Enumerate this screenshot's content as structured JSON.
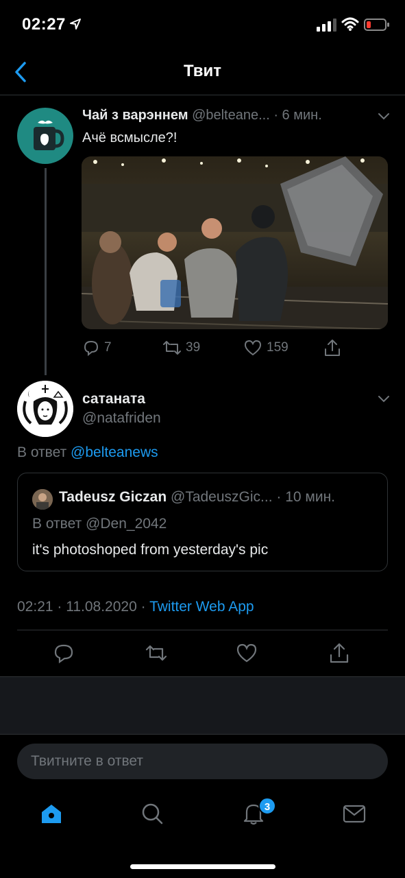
{
  "status_bar": {
    "time": "02:27"
  },
  "header": {
    "title": "Твит"
  },
  "parent_tweet": {
    "name": "Чай з варэннем",
    "handle": "@belteane...",
    "time": "· 6 мин.",
    "text": "Ачё всмысле?!",
    "replies": "7",
    "retweets": "39",
    "likes": "159"
  },
  "reply_tweet": {
    "name": "сатаната",
    "handle": "@natafriden",
    "reply_prefix": "В ответ",
    "reply_to": "@belteanews",
    "quoted": {
      "name": "Tadeusz Giczan",
      "handle": "@TadeuszGic...",
      "time": "· 10 мин.",
      "reply_prefix": "В ответ",
      "reply_to": "@Den_2042",
      "text": "it's photoshoped from yesterday's pic"
    },
    "timestamp": "02:21 · 11.08.2020 ·",
    "source": "Twitter Web App"
  },
  "reply_box": {
    "placeholder": "Твитните в ответ"
  },
  "tab_bar": {
    "notifications_badge": "3"
  },
  "colors": {
    "accent": "#1d9bf0",
    "background": "#000000",
    "muted": "#71767b"
  }
}
